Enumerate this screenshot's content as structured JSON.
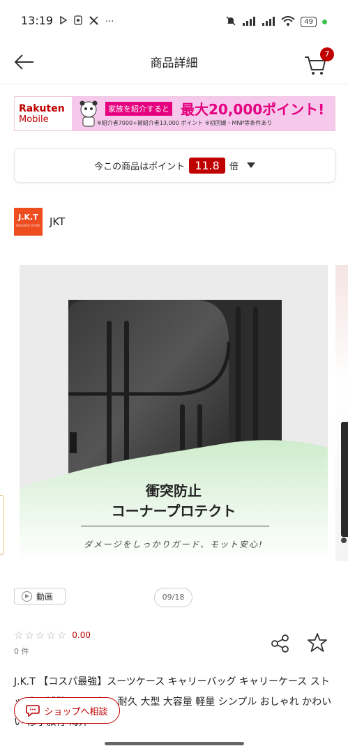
{
  "status_bar": {
    "time": "13:19",
    "left_icons": [
      "play-icon",
      "nfc-icon",
      "x-logo-icon"
    ],
    "more": "···",
    "battery": "49"
  },
  "header": {
    "title": "商品詳細",
    "cart_count": "7"
  },
  "banner": {
    "logo_line1": "Rakuten",
    "logo_line2": "Mobile",
    "tag": "家族を紹介すると",
    "headline": "最大20,000ポイント!",
    "note": "※紹介者7000+被紹介者13,000 ポイント ※初回線・MNP等条件あり"
  },
  "points": {
    "prefix": "今この商品はポイント",
    "value": "11.8",
    "suffix": "倍"
  },
  "shop": {
    "logo_text": "J.K.T",
    "logo_sub": "BAGGAGE STORE",
    "name": "JKT"
  },
  "image": {
    "caption_line1": "衝突防止",
    "caption_line2": "コーナープロテクト",
    "caption_sub": "ダメージをしっかりガード、モット安心!"
  },
  "video_label": "動画",
  "image_counter": "09/18",
  "rating": {
    "score": "0.00",
    "review_count": "0 件"
  },
  "product": {
    "title": "J.K.T 【コスパ最強】スーツケース キャリーバッグ キャリーケース ストッパー 補助キャスター 耐久 大型 大容量 軽量 シンプル おしゃれ かわいい 修学旅行 海外"
  },
  "chat": {
    "label": "ショップへ相談"
  },
  "colors": {
    "rakuten_red": "#bf0000",
    "banner_pink": "#f6c9ec",
    "banner_magenta": "#e5007f",
    "shop_orange": "#ee4d1f"
  }
}
